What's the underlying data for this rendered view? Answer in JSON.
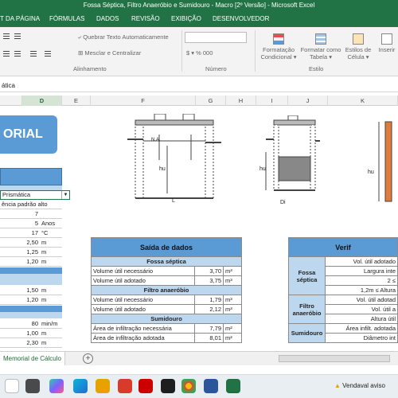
{
  "window": {
    "title": "Fossa Séptica, Filtro Anaeróbio e Sumidouro - Macro [2º Versão] - Microsoft Excel"
  },
  "ribbon_tabs": [
    "T DA PÁGINA",
    "FÓRMULAS",
    "DADOS",
    "REVISÃO",
    "EXIBIÇÃO",
    "DESENVOLVEDOR"
  ],
  "ribbon": {
    "wrap_text": "Quebrar Texto Automaticamente",
    "merge_center": "Mesclar e Centralizar",
    "number_symbols": "$ ▾ % 000",
    "cond_format": [
      "Formatação",
      "Condicional ▾"
    ],
    "format_table": [
      "Formatar como",
      "Tabela ▾"
    ],
    "cell_styles": [
      "Estilos de",
      "Célula ▾"
    ],
    "insert": "Inserir",
    "group_alignment": "Alinhamento",
    "group_number": "Número",
    "group_styles": "Estilo"
  },
  "formula_bar": {
    "content": "ática"
  },
  "columns": [
    "D",
    "E",
    "F",
    "G",
    "H",
    "I",
    "J",
    "K"
  ],
  "left_panel": {
    "title": "ORIAL",
    "dropdown_value": "Prismática",
    "rows": [
      {
        "value": "ência padrão alto",
        "unit": ""
      },
      {
        "value": "7",
        "unit": ""
      },
      {
        "value": "5",
        "unit": "Anos"
      },
      {
        "value": "17",
        "unit": "°C"
      },
      {
        "value": "2,50",
        "unit": "m"
      },
      {
        "value": "1,25",
        "unit": "m"
      },
      {
        "value": "1,20",
        "unit": "m"
      },
      {
        "value": "1,50",
        "unit": "m"
      },
      {
        "value": "1,20",
        "unit": "m"
      },
      {
        "value": "80",
        "unit": "min/m"
      },
      {
        "value": "1,00",
        "unit": "m"
      },
      {
        "value": "2,30",
        "unit": "m"
      }
    ]
  },
  "diagrams": {
    "fossa": {
      "na": "N.A.",
      "hu": "hu",
      "l": "L"
    },
    "filtro": {
      "hu": "hu",
      "di": "Di"
    },
    "sumidouro": {
      "hu": "hu"
    }
  },
  "output": {
    "title": "Saída de dados",
    "sections": [
      {
        "name": "Fossa séptica",
        "rows": [
          {
            "label": "Volume útil necessário",
            "value": "3,70",
            "unit": "m³"
          },
          {
            "label": "Volume útil adotado",
            "value": "3,75",
            "unit": "m³"
          }
        ]
      },
      {
        "name": "Filtro anaeróbio",
        "rows": [
          {
            "label": "Volume útil necessário",
            "value": "1,79",
            "unit": "m³"
          },
          {
            "label": "Volume útil adotado",
            "value": "2,12",
            "unit": "m³"
          }
        ]
      },
      {
        "name": "Sumidouro",
        "rows": [
          {
            "label": "Área de infiltração necessária",
            "value": "7,79",
            "unit": "m²"
          },
          {
            "label": "Área de infiltração adotada",
            "value": "8,01",
            "unit": "m²"
          }
        ]
      }
    ]
  },
  "verify": {
    "title": "Verif",
    "groups": [
      {
        "name": "Fossa séptica",
        "rows": [
          "Vol. útil adotado",
          "Largura inte",
          "2 ≤",
          "1,2m ≤ Altura"
        ]
      },
      {
        "name": "Filtro anaeróbio",
        "rows": [
          "Vol. útil adotad",
          "Vol. útil a",
          "Altura útil"
        ]
      },
      {
        "name": "Sumidouro",
        "rows": [
          "Área infilt. adotada",
          "Diâmetro int"
        ]
      }
    ]
  },
  "sheet_tab": "Memorial de Cálculo",
  "taskbar": {
    "notification": "Vendaval aviso"
  }
}
